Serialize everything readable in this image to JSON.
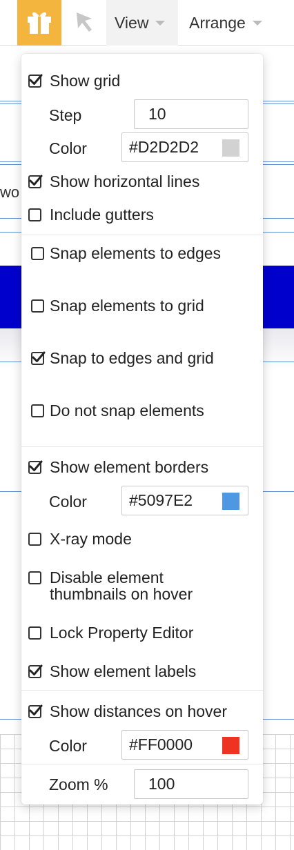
{
  "toolbar": {
    "gift_icon": "gift-icon",
    "pointer_icon": "pointer-icon",
    "view_label": "View",
    "arrange_label": "Arrange",
    "accent_color": "#F4B53F"
  },
  "background": {
    "peek_text": "wo"
  },
  "menu": {
    "show_grid": {
      "label": "Show grid",
      "checked": true
    },
    "step": {
      "label": "Step",
      "value": "10"
    },
    "grid_color": {
      "label": "Color",
      "value": "#D2D2D2",
      "swatch": "#D2D2D2"
    },
    "show_horizontal_lines": {
      "label": "Show horizontal lines",
      "checked": true
    },
    "include_gutters": {
      "label": "Include gutters",
      "checked": false
    },
    "snap_edges": {
      "label": "Snap elements to edges",
      "checked": false
    },
    "snap_grid": {
      "label": "Snap elements to grid",
      "checked": false
    },
    "snap_edges_grid": {
      "label": "Snap to edges and grid",
      "checked": true
    },
    "no_snap": {
      "label": "Do not snap elements",
      "checked": false
    },
    "show_borders": {
      "label": "Show element borders",
      "checked": true
    },
    "border_color": {
      "label": "Color",
      "value": "#5097E2",
      "swatch": "#5097E2"
    },
    "xray": {
      "label": "X-ray mode",
      "checked": false
    },
    "disable_thumbnails": {
      "label_line1": "Disable element",
      "label_line2": "thumbnails on hover",
      "checked": false
    },
    "lock_editor": {
      "label": "Lock Property Editor",
      "checked": false
    },
    "show_labels": {
      "label": "Show element labels",
      "checked": true
    },
    "show_distances": {
      "label": "Show distances on hover",
      "checked": true
    },
    "distance_color": {
      "label": "Color",
      "value": "#FF0000",
      "swatch": "#EE3322"
    },
    "zoom": {
      "label": "Zoom %",
      "value": "100"
    }
  }
}
